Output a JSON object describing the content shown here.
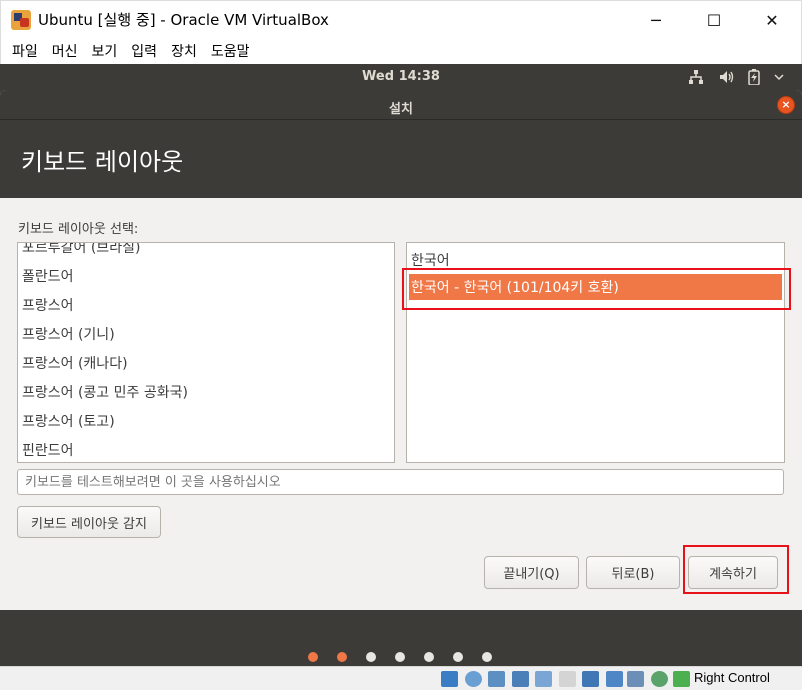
{
  "window": {
    "title": "Ubuntu [실행 중] - Oracle VM VirtualBox",
    "minimize_glyph": "─",
    "maximize_glyph": "☐",
    "close_glyph": "✕"
  },
  "vbox_menu": [
    "파일",
    "머신",
    "보기",
    "입력",
    "장치",
    "도움말"
  ],
  "guest_topbar": {
    "clock": "Wed 14:38"
  },
  "installer": {
    "window_title": "설치",
    "close_glyph": "×",
    "page_title": "키보드 레이아웃",
    "layout_label": "키보드 레이아웃 선택:",
    "left_list": [
      "포르투갈어 (브라질)",
      "폴란드어",
      "프랑스어",
      "프랑스어 (기니)",
      "프랑스어 (캐나다)",
      "프랑스어 (콩고 민주 공화국)",
      "프랑스어 (토고)",
      "핀란드어"
    ],
    "right_list": [
      "한국어",
      "한국어 - 한국어 (101/104키 호환)"
    ],
    "selected_variant_index": 1,
    "test_placeholder": "키보드를 테스트해보려면 이 곳을 사용하십시오",
    "detect_button": "키보드 레이아웃 감지",
    "quit_button": "끝내기(Q)",
    "back_button": "뒤로(B)",
    "continue_button": "계속하기"
  },
  "progress": {
    "total_steps": 7,
    "active_steps": 2
  },
  "statusbar": {
    "host_key": "Right Control"
  },
  "colors": {
    "accent": "#f07746",
    "highlight_box": "#e8111a",
    "ubuntu_dark": "#3c3b37"
  }
}
